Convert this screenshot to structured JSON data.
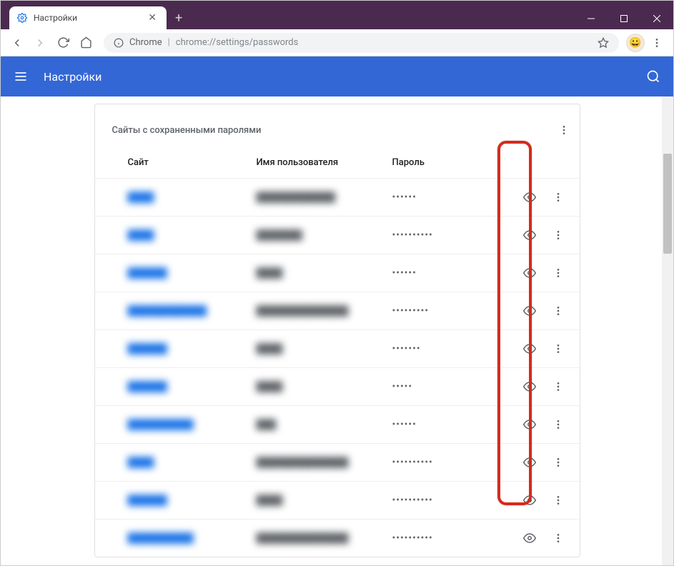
{
  "window": {
    "tab_title": "Настройки",
    "url_prefix": "Chrome",
    "url_path": "chrome://settings/passwords"
  },
  "header": {
    "title": "Настройки"
  },
  "card": {
    "title": "Сайты с сохраненными паролями",
    "columns": {
      "site": "Сайт",
      "username": "Имя пользователя",
      "password": "Пароль"
    }
  },
  "rows": [
    {
      "site": "████",
      "user": "████████████",
      "pass": "••••••"
    },
    {
      "site": "████",
      "user": "███████",
      "pass": "••••••••••"
    },
    {
      "site": "██████",
      "user": "████",
      "pass": "••••••"
    },
    {
      "site": "████████████",
      "user": "██████████████",
      "pass": "•••••••••"
    },
    {
      "site": "██████",
      "user": "████",
      "pass": "•••••••"
    },
    {
      "site": "██████",
      "user": "████",
      "pass": "•••••"
    },
    {
      "site": "██████████",
      "user": "███",
      "pass": "••••••"
    },
    {
      "site": "████",
      "user": "██████████████",
      "pass": "••••••••••"
    },
    {
      "site": "██████",
      "user": "████",
      "pass": "••••••••••"
    },
    {
      "site": "██████████",
      "user": "██████████████",
      "pass": "••••••••••"
    }
  ]
}
